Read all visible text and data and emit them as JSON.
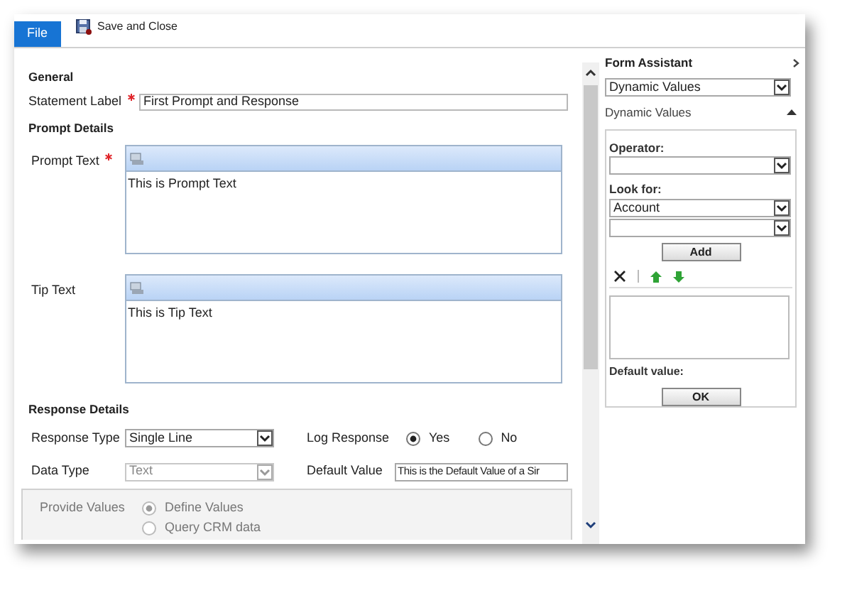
{
  "tabs": [
    {
      "label": "File",
      "selected": true
    }
  ],
  "toolbar": [
    {
      "label": "Save and Close"
    }
  ],
  "general": {
    "title": "General",
    "fields": [
      {
        "label": "Statement Label",
        "required": true,
        "value": "First Prompt and Response"
      }
    ]
  },
  "prompt_details": {
    "title": "Prompt Details",
    "editors": [
      {
        "label": "Prompt Text",
        "required": true,
        "value": "This is Prompt Text"
      },
      {
        "label": "Tip Text",
        "required": false,
        "value": "This is Tip Text"
      }
    ]
  },
  "response_details": {
    "title": "Response Details",
    "fields": [
      {
        "kind": "select",
        "label": "Response Type",
        "value": "Single Line",
        "disabled": false
      },
      {
        "kind": "radio",
        "label": "Log Response",
        "options": [
          {
            "label": "Yes",
            "selected": true
          },
          {
            "label": "No",
            "selected": false
          }
        ]
      },
      {
        "kind": "select",
        "label": "Data Type",
        "value": "Text",
        "disabled": true
      },
      {
        "kind": "text",
        "label": "Default Value",
        "value": "This is the Default Value of a Sir"
      }
    ]
  },
  "provide_values": {
    "label": "Provide Values",
    "disabled": true,
    "options": [
      {
        "label": "Define Values",
        "selected": true
      },
      {
        "label": "Query CRM data",
        "selected": false
      }
    ]
  },
  "assistant": {
    "title": "Form Assistant",
    "dropdown": "Dynamic Values",
    "section_title": "Dynamic Values",
    "expanded": true,
    "operator_label": "Operator:",
    "look_for_label": "Look for:",
    "look_for_value": "Account",
    "add_button": "Add",
    "default_label": "Default value:",
    "ok_button": "OK"
  }
}
